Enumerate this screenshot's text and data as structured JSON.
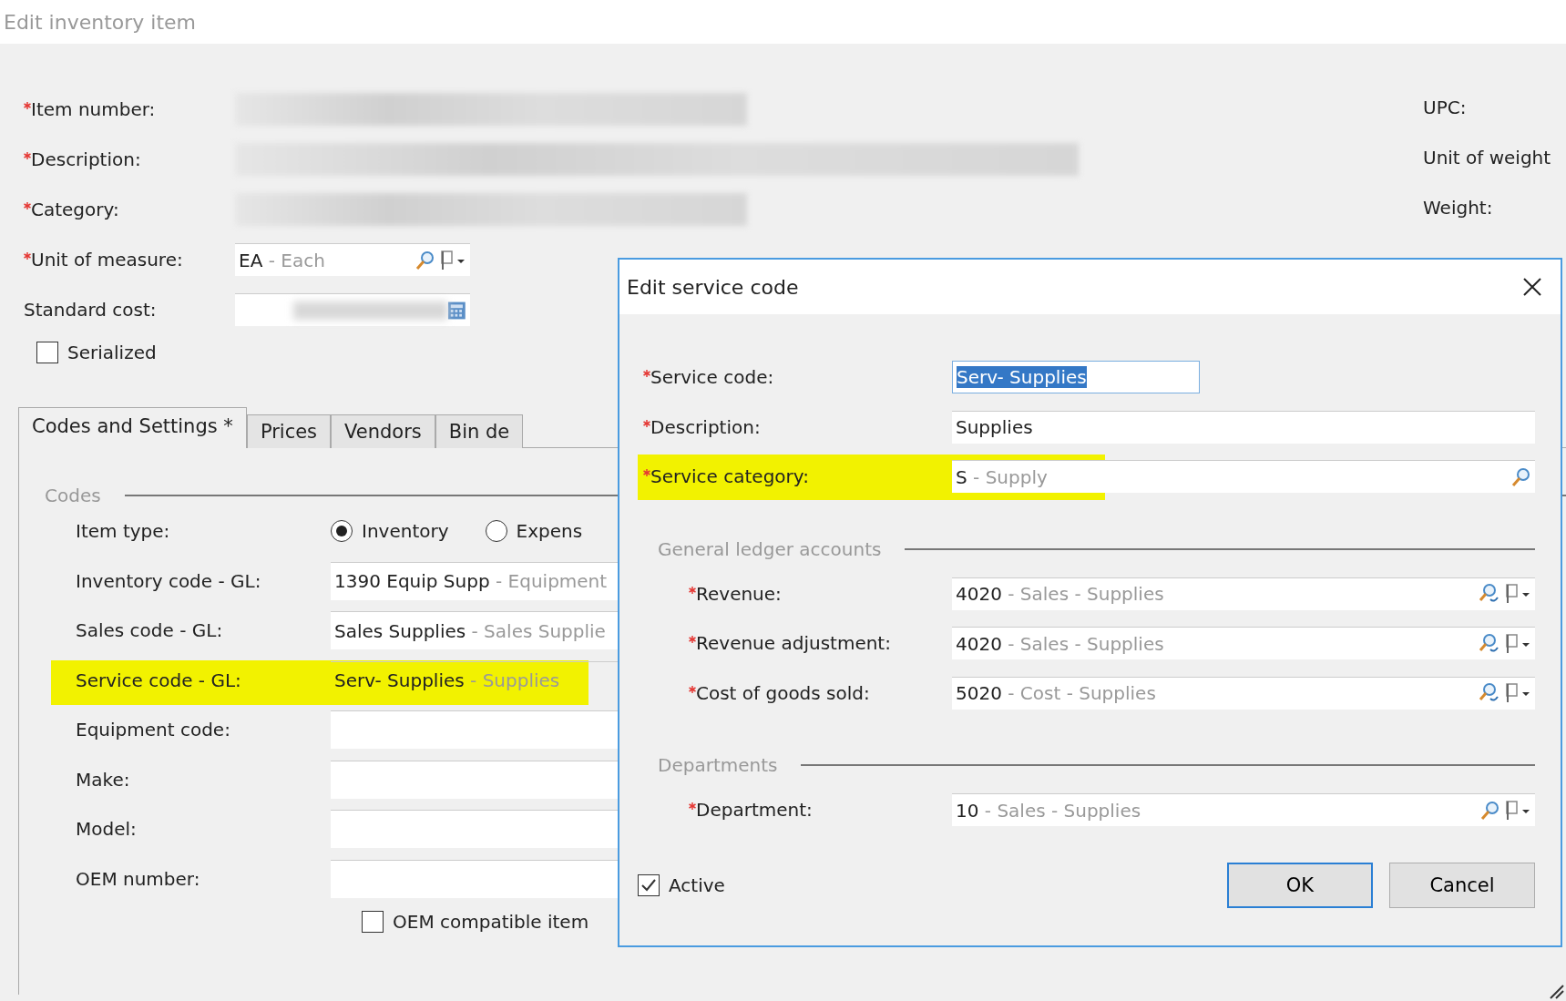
{
  "window": {
    "title": "Edit inventory item"
  },
  "main_fields": [
    {
      "label": "Item number:",
      "required": true,
      "kind": "blurred"
    },
    {
      "label": "Description:",
      "required": true,
      "kind": "blurred_wide"
    },
    {
      "label": "Category:",
      "required": true,
      "kind": "blurred"
    },
    {
      "label": "Unit of measure:",
      "required": true,
      "kind": "lookup",
      "value": "EA",
      "detail": "- Each"
    },
    {
      "label": "Standard cost:",
      "required": false,
      "kind": "blurred_calc"
    }
  ],
  "serialized": {
    "label": "Serialized",
    "checked": false
  },
  "right_labels": [
    "UPC:",
    "Unit of weight",
    "Weight:"
  ],
  "tabs": [
    {
      "label": "Codes and Settings *",
      "selected": true
    },
    {
      "label": "Prices",
      "selected": false
    },
    {
      "label": "Vendors",
      "selected": false
    },
    {
      "label": "Bin de",
      "selected": false
    }
  ],
  "codes": {
    "legend": "Codes",
    "item_type": {
      "label": "Item type:",
      "options": [
        {
          "label": "Inventory",
          "selected": true
        },
        {
          "label": "Expens",
          "selected": false
        }
      ]
    },
    "fields": [
      {
        "label": "Inventory code - GL:",
        "value": "1390 Equip Supp",
        "detail": "- Equipment",
        "highlighted": false
      },
      {
        "label": "Sales code - GL:",
        "value": "Sales Supplies",
        "detail": "- Sales Supplie",
        "highlighted": false
      },
      {
        "label": "Service code - GL:",
        "value": "Serv- Supplies",
        "detail": "- Supplies",
        "highlighted": true
      },
      {
        "label": "Equipment code:",
        "highlighted": false
      },
      {
        "label": "Make:",
        "highlighted": false
      },
      {
        "label": "Model:",
        "highlighted": false
      },
      {
        "label": "OEM number:",
        "highlighted": false
      }
    ],
    "oem_compatible": {
      "label": "OEM compatible item",
      "checked": false
    }
  },
  "dialog": {
    "title": "Edit service code",
    "fields": [
      {
        "label": "Service code:",
        "kind": "short",
        "value": "Serv- Supplies",
        "selected": true,
        "highlighted": false
      },
      {
        "label": "Description:",
        "kind": "text",
        "value": "Supplies",
        "selected": false,
        "highlighted": false
      },
      {
        "label": "Service category:",
        "kind": "search",
        "value": "S",
        "detail": "- Supply",
        "selected": false,
        "highlighted": true
      }
    ],
    "sections": [
      {
        "legend": "General ledger accounts",
        "fields": [
          {
            "label": "Revenue:",
            "kind": "account",
            "value": "4020",
            "detail": "- Sales - Supplies"
          },
          {
            "label": "Revenue adjustment:",
            "kind": "account",
            "value": "4020",
            "detail": "- Sales - Supplies"
          },
          {
            "label": "Cost of goods sold:",
            "kind": "account",
            "value": "5020",
            "detail": "- Cost - Supplies"
          }
        ]
      },
      {
        "legend": "Departments",
        "fields": [
          {
            "label": "Department:",
            "kind": "lookup",
            "value": "10",
            "detail": "- Sales - Supplies"
          }
        ]
      }
    ],
    "active": {
      "label": "Active",
      "checked": true
    },
    "buttons": [
      {
        "label": "OK",
        "default": true
      },
      {
        "label": "Cancel",
        "default": false
      }
    ]
  }
}
